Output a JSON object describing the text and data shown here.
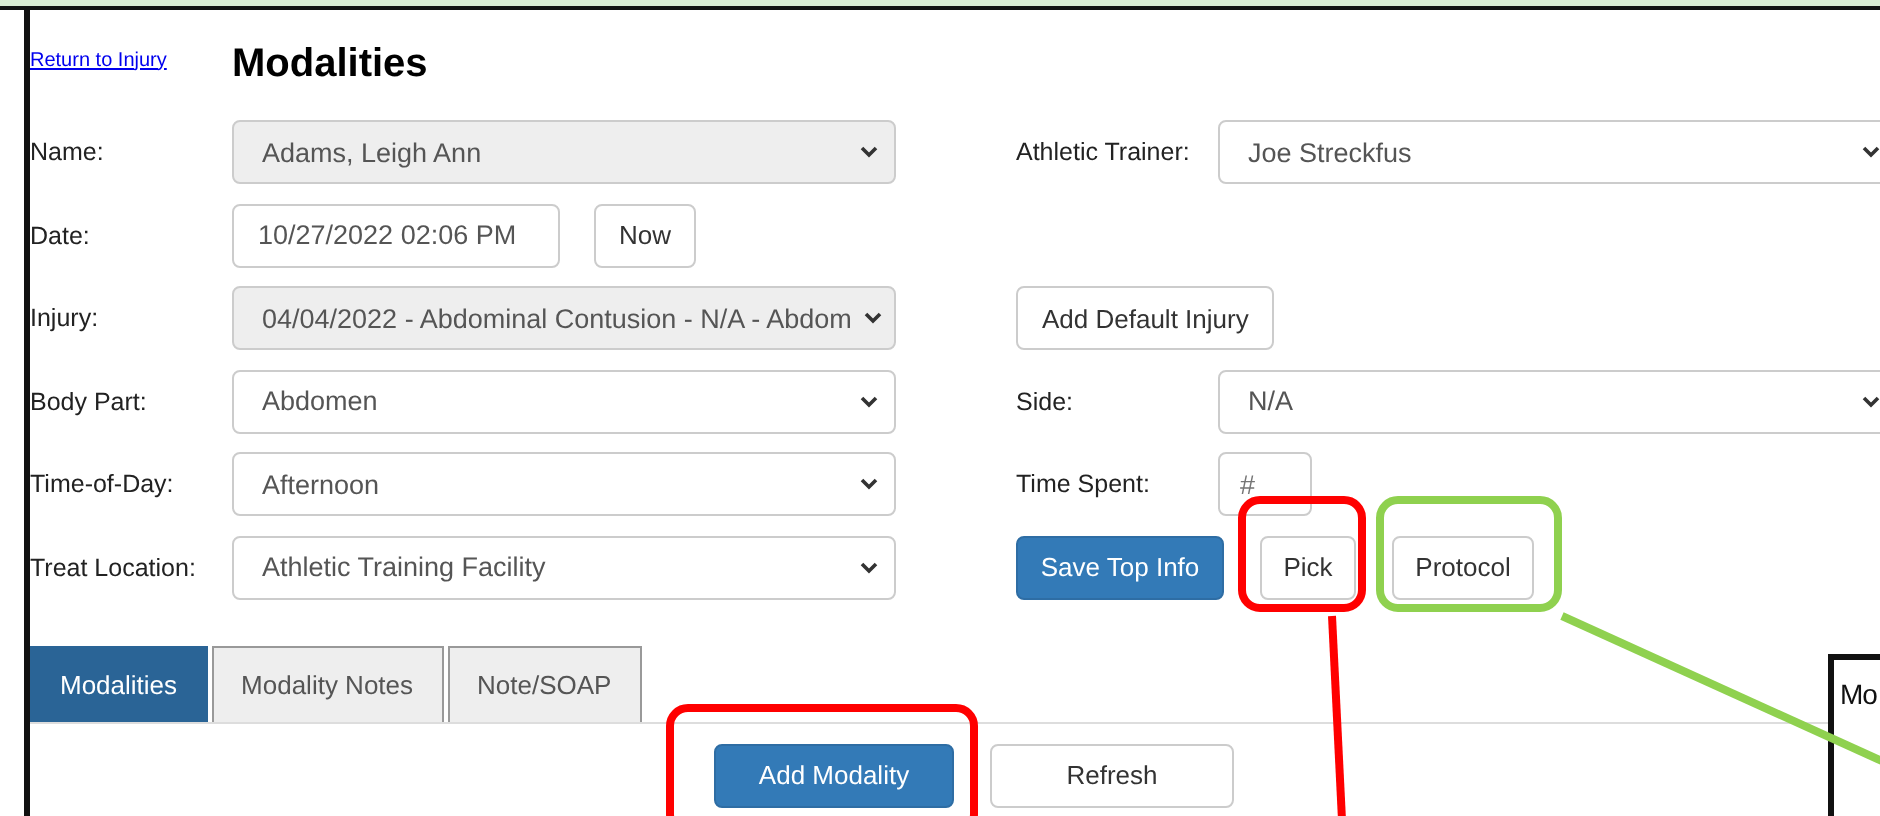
{
  "link": "Return to Injury",
  "title": "Modalities",
  "rows": [
    {
      "label": "Name:",
      "field": {
        "kind": "select",
        "value": "Adams, Leigh Ann",
        "disabled": true
      },
      "right": {
        "kind": "select",
        "label": "Athletic Trainer:",
        "value": "Joe Streckfus",
        "disabled": false
      }
    },
    {
      "label": "Date:",
      "field": {
        "kind": "datetime",
        "value": "10/27/2022 02:06 PM",
        "button": "Now"
      },
      "right": {
        "kind": "empty"
      }
    },
    {
      "label": "Injury:",
      "field": {
        "kind": "select",
        "value": "04/04/2022 - Abdominal Contusion - N/A - Abdom",
        "disabled": true
      },
      "right": {
        "kind": "button",
        "button": "Add Default Injury"
      }
    },
    {
      "label": "Body Part:",
      "field": {
        "kind": "select",
        "value": "Abdomen",
        "disabled": false
      },
      "right": {
        "kind": "select",
        "label": "Side:",
        "value": "N/A",
        "disabled": false
      }
    },
    {
      "label": "Time-of-Day:",
      "field": {
        "kind": "select",
        "value": "Afternoon",
        "disabled": false
      },
      "right": {
        "kind": "number",
        "label": "Time Spent:",
        "placeholder": "#"
      }
    },
    {
      "label": "Treat Location:",
      "field": {
        "kind": "select",
        "value": "Athletic Training Facility",
        "disabled": false
      },
      "right": {
        "kind": "buttons",
        "buttons": [
          {
            "label": "Save Top Info",
            "primary": true
          },
          {
            "label": "Pick",
            "primary": false
          },
          {
            "label": "Protocol",
            "primary": false
          }
        ]
      }
    }
  ],
  "tabs": [
    {
      "label": "Modalities",
      "selected": true
    },
    {
      "label": "Modality Notes",
      "selected": false
    },
    {
      "label": "Note/SOAP",
      "selected": false
    }
  ],
  "actions": [
    {
      "label": "Add Modality",
      "primary": true
    },
    {
      "label": "Refresh",
      "primary": false
    }
  ],
  "side_panel": {
    "text": "Mo"
  },
  "annotations": [
    {
      "color": "#ff0000"
    },
    {
      "color": "#8fd14f"
    },
    {
      "color": "#ff0000"
    }
  ]
}
